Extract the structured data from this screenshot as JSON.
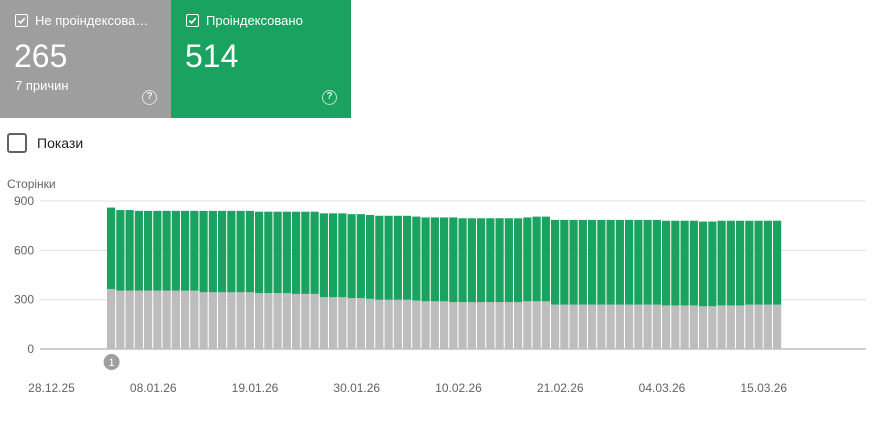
{
  "cards": [
    {
      "title": "Не проіндексова…",
      "value": "265",
      "subtitle": "7 причин",
      "color": "#9e9e9e",
      "checked": true
    },
    {
      "title": "Проіндексовано",
      "value": "514",
      "subtitle": "",
      "color": "#1aa260",
      "checked": true
    }
  ],
  "show_toggle": {
    "label": "Покази",
    "checked": false
  },
  "icons": {
    "card_check": "checkbox-checked-icon",
    "card_help": "help-circle-icon",
    "show_box": "checkbox-empty-icon"
  },
  "chart_data": {
    "type": "bar",
    "stacked": true,
    "ylabel": "Сторінки",
    "ylim": [
      0,
      900
    ],
    "yticks": [
      0,
      300,
      600,
      900
    ],
    "x_tick_labels": [
      "28.12.25",
      "08.01.26",
      "19.01.26",
      "30.01.26",
      "10.02.26",
      "21.02.26",
      "04.03.26",
      "15.03.26"
    ],
    "annotation": {
      "label": "1",
      "date": "03.01.26"
    },
    "grid": true,
    "start_date": "03.01.26",
    "series": [
      {
        "key": "not_indexed",
        "color": "#bdbdbd",
        "values": [
          365,
          355,
          355,
          355,
          355,
          355,
          355,
          355,
          355,
          355,
          345,
          345,
          345,
          345,
          345,
          345,
          340,
          340,
          340,
          340,
          335,
          335,
          335,
          315,
          315,
          315,
          310,
          310,
          305,
          300,
          300,
          300,
          300,
          295,
          290,
          290,
          290,
          285,
          285,
          285,
          285,
          285,
          285,
          285,
          285,
          290,
          290,
          290,
          270,
          270,
          270,
          270,
          270,
          270,
          270,
          270,
          270,
          270,
          270,
          270,
          265,
          265,
          265,
          265,
          260,
          260,
          265,
          265,
          265,
          270,
          270,
          270,
          270
        ]
      },
      {
        "key": "indexed",
        "color": "#1aa260",
        "values": [
          495,
          490,
          490,
          485,
          485,
          485,
          485,
          485,
          485,
          485,
          495,
          495,
          495,
          495,
          495,
          495,
          495,
          495,
          495,
          495,
          500,
          500,
          500,
          510,
          510,
          510,
          510,
          510,
          510,
          510,
          510,
          510,
          510,
          510,
          510,
          510,
          510,
          515,
          510,
          510,
          510,
          510,
          510,
          510,
          510,
          510,
          515,
          515,
          515,
          515,
          515,
          515,
          515,
          515,
          515,
          515,
          515,
          515,
          515,
          515,
          515,
          515,
          515,
          515,
          515,
          515,
          515,
          515,
          515,
          510,
          510,
          510,
          510
        ]
      }
    ]
  },
  "colors": {
    "indexed": "#1aa260",
    "not_indexed": "#bdbdbd",
    "gray_card": "#9e9e9e",
    "grid": "#e0e0e0",
    "axis_text": "#5f6368",
    "annotation": "#9e9e9e"
  }
}
